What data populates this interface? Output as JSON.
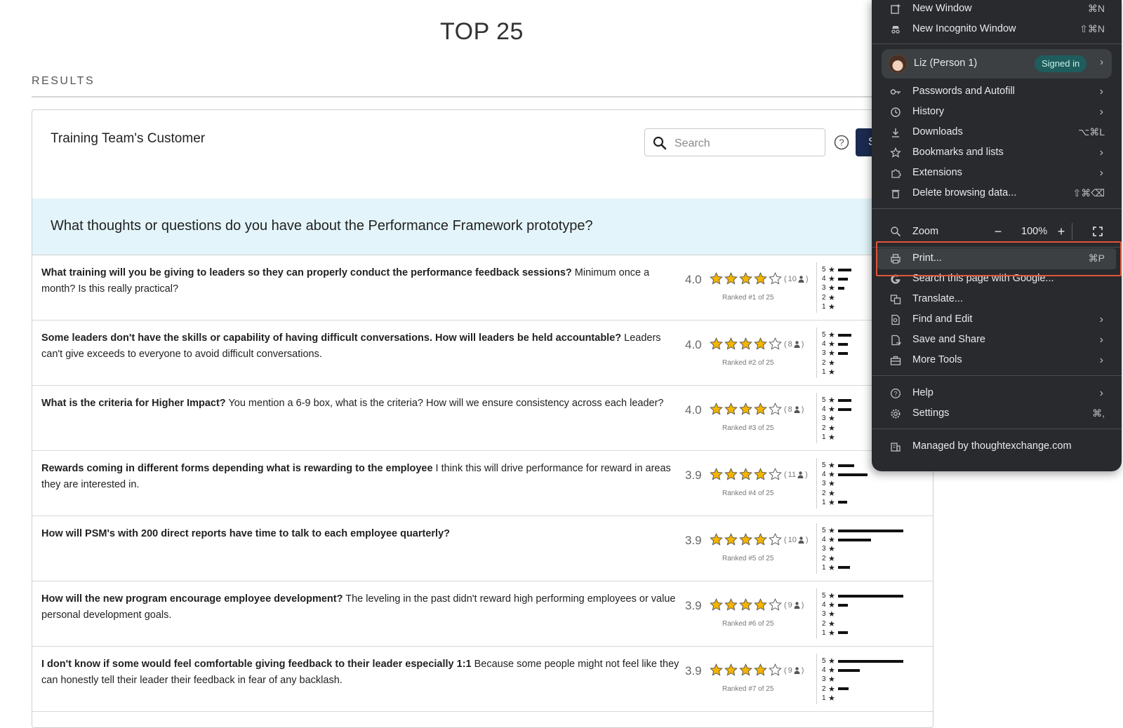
{
  "page": {
    "title": "TOP 25",
    "results_label": "RESULTS"
  },
  "card": {
    "title": "Training Team's Customer",
    "search_placeholder": "Search",
    "search_button_label": "S",
    "question": "What thoughts or questions do you have about the Performance Framework prototype?"
  },
  "results": [
    {
      "bold": "What training will you be giving to leaders so they can properly conduct the performance feedback sessions?",
      "rest": " Minimum once a month? Is this really practical?",
      "score": "4.0",
      "stars": 4,
      "votes": "10",
      "rank": "Ranked #1 of 25",
      "dist": [
        0.2,
        0.15,
        0.1,
        0,
        0
      ]
    },
    {
      "bold": "Some leaders don't have the skills or capability of having difficult conversations. How will leaders be held accountable?",
      "rest": " Leaders can't give exceeds to everyone to avoid difficult conversations.",
      "score": "4.0",
      "stars": 4,
      "votes": "8",
      "rank": "Ranked #2 of 25",
      "dist": [
        0.2,
        0.15,
        0.15,
        0,
        0
      ]
    },
    {
      "bold": "What is the criteria for Higher Impact?",
      "rest": " You mention a 6-9 box, what is the criteria? How will we ensure consistency across each leader?",
      "score": "4.0",
      "stars": 4,
      "votes": "8",
      "rank": "Ranked #3 of 25",
      "dist": [
        0.2,
        0.2,
        0,
        0,
        0
      ]
    },
    {
      "bold": "Rewards coming in different forms depending what is rewarding to the employee",
      "rest": " I think this will drive performance for reward in areas they are interested in.",
      "score": "3.9",
      "stars": 4,
      "votes": "11",
      "rank": "Ranked #4 of 25",
      "dist": [
        0.25,
        0.45,
        0,
        0,
        0.14
      ]
    },
    {
      "bold": "How will PSM's with 200 direct reports have time to talk to each employee quarterly?",
      "rest": "",
      "score": "3.9",
      "stars": 4,
      "votes": "10",
      "rank": "Ranked #5 of 25",
      "dist": [
        1.0,
        0.5,
        0,
        0,
        0.18
      ]
    },
    {
      "bold": "How will the new program encourage employee development?",
      "rest": " The leveling in the past didn't reward high performing employees or value personal development goals.",
      "score": "3.9",
      "stars": 4,
      "votes": "9",
      "rank": "Ranked #6 of 25",
      "dist": [
        1.0,
        0.15,
        0,
        0,
        0.15
      ]
    },
    {
      "bold": "I don't know if some would feel comfortable giving feedback to their leader especially 1:1",
      "rest": " Because some people might not feel like they can honestly tell their leader their feedback in fear of any backlash.",
      "score": "3.9",
      "stars": 4,
      "votes": "9",
      "rank": "Ranked #7 of 25",
      "dist": [
        1.0,
        0.33,
        0,
        0.16,
        0
      ]
    }
  ],
  "menu": {
    "new_window": {
      "label": "New Window",
      "shortcut": "⌘N"
    },
    "new_incognito": {
      "label": "New Incognito Window",
      "shortcut": "⇧⌘N"
    },
    "profile": {
      "name": "Liz (Person 1)",
      "status": "Signed in"
    },
    "passwords": {
      "label": "Passwords and Autofill"
    },
    "history": {
      "label": "History"
    },
    "downloads": {
      "label": "Downloads",
      "shortcut": "⌥⌘L"
    },
    "bookmarks": {
      "label": "Bookmarks and lists"
    },
    "extensions": {
      "label": "Extensions"
    },
    "delete_data": {
      "label": "Delete browsing data...",
      "shortcut": "⇧⌘⌫"
    },
    "zoom": {
      "label": "Zoom",
      "value": "100%"
    },
    "print": {
      "label": "Print...",
      "shortcut": "⌘P"
    },
    "search_google": {
      "label": "Search this page with Google..."
    },
    "translate": {
      "label": "Translate..."
    },
    "find_edit": {
      "label": "Find and Edit"
    },
    "save_share": {
      "label": "Save and Share"
    },
    "more_tools": {
      "label": "More Tools"
    },
    "help": {
      "label": "Help"
    },
    "settings": {
      "label": "Settings",
      "shortcut": "⌘,"
    },
    "managed": {
      "label": "Managed by thoughtexchange.com"
    }
  },
  "colors": {
    "star_fill": "#f4b400",
    "menu_bg": "#282a2d",
    "highlight_border": "#e2533a",
    "banner_bg": "#e3f5fa",
    "button_bg": "#1b2a4e"
  }
}
